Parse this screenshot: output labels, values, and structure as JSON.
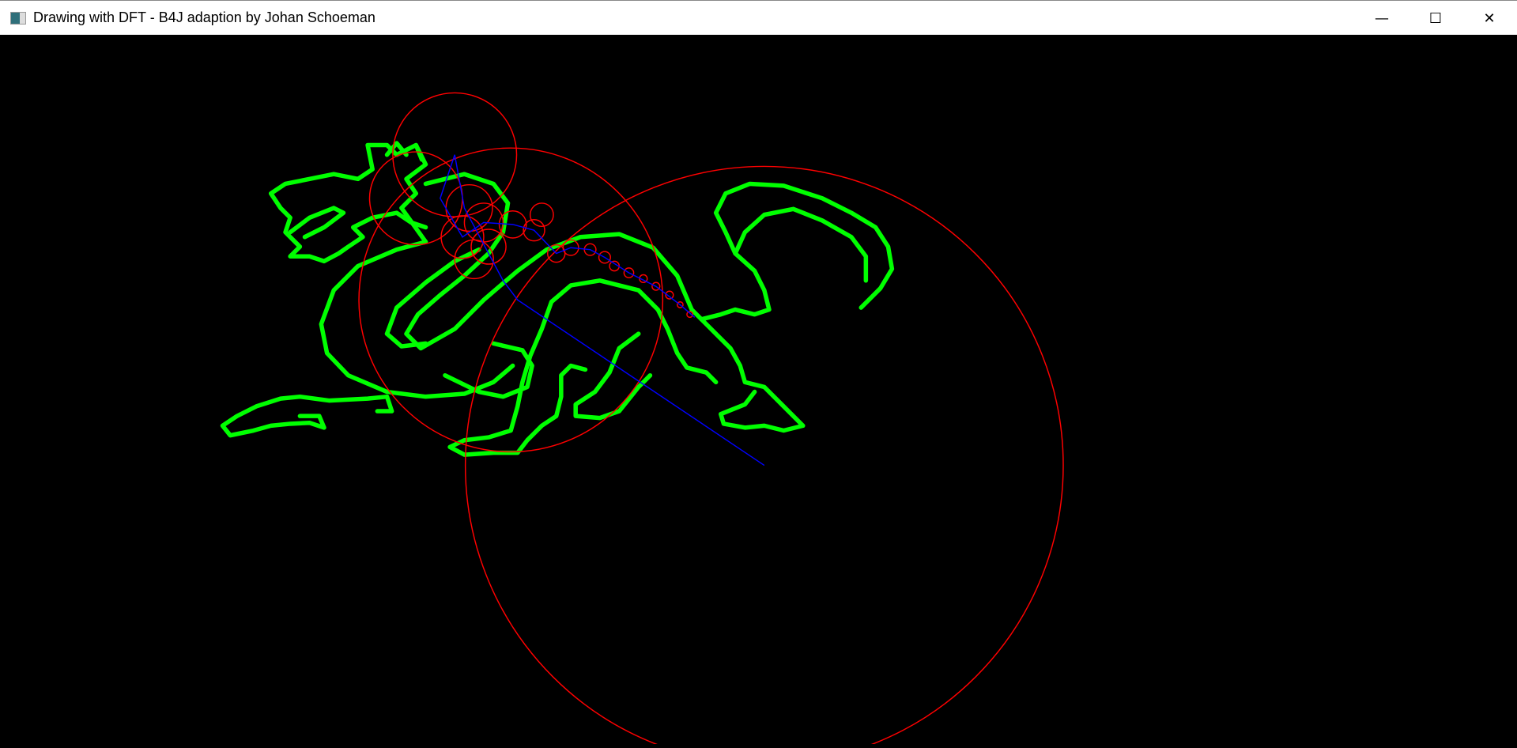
{
  "window": {
    "title": "Drawing with DFT - B4J adaption by Johan Schoeman",
    "icon": "app-window-icon",
    "controls": {
      "minimize": "—",
      "maximize": "☐",
      "close": "✕"
    }
  },
  "colors": {
    "background": "#000000",
    "drawing": "#00ff00",
    "epicycles": "#ff0000",
    "arms": "#0000ff"
  }
}
